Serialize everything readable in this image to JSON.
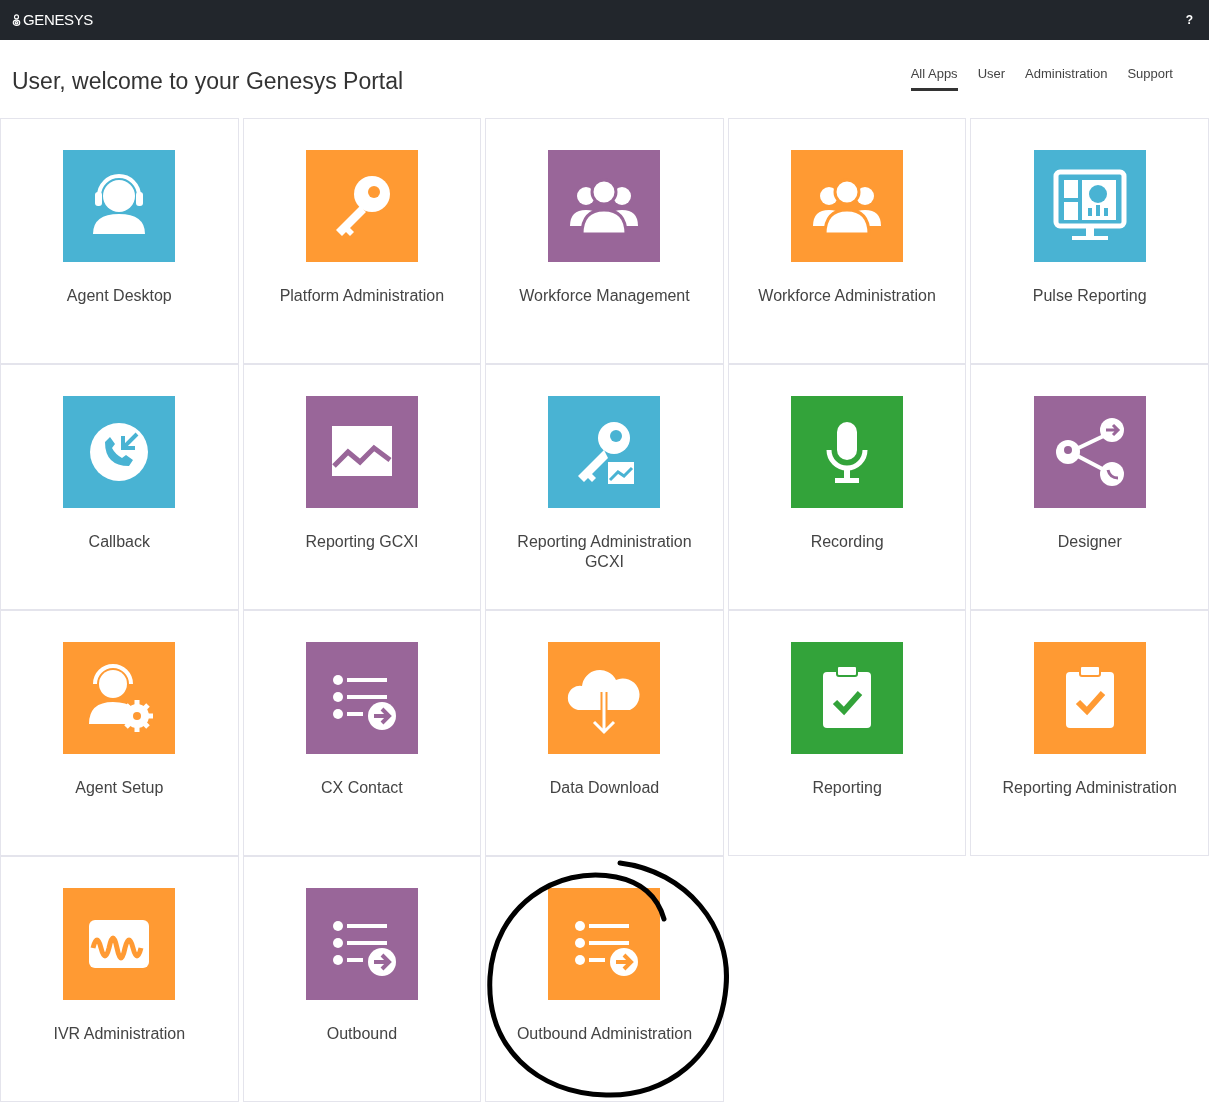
{
  "header": {
    "logo": "GENESYS",
    "help": "?"
  },
  "welcome": "User, welcome to your Genesys Portal",
  "tabs": [
    {
      "label": "All Apps",
      "selected": true
    },
    {
      "label": "User",
      "selected": false
    },
    {
      "label": "Administration",
      "selected": false
    },
    {
      "label": "Support",
      "selected": false
    }
  ],
  "apps": [
    {
      "label": "Agent Desktop",
      "kind": "headset",
      "color": "#49b3d3",
      "circled": false
    },
    {
      "label": "Platform Administration",
      "kind": "key",
      "color": "#ff9a33",
      "circled": false
    },
    {
      "label": "Workforce Management",
      "kind": "group",
      "color": "#996699",
      "circled": false
    },
    {
      "label": "Workforce Administration",
      "kind": "group",
      "color": "#ff9a33",
      "circled": false
    },
    {
      "label": "Pulse Reporting",
      "kind": "monitor",
      "color": "#49b3d3",
      "circled": false
    },
    {
      "label": "Callback",
      "kind": "phone",
      "color": "#49b3d3",
      "circled": false
    },
    {
      "label": "Reporting GCXI",
      "kind": "chart",
      "color": "#996699",
      "circled": false
    },
    {
      "label": "Reporting Administration GCXI",
      "kind": "keychart",
      "color": "#49b3d3",
      "circled": false
    },
    {
      "label": "Recording",
      "kind": "mic",
      "color": "#33a33a",
      "circled": false
    },
    {
      "label": "Designer",
      "kind": "share",
      "color": "#996699",
      "circled": false
    },
    {
      "label": "Agent Setup",
      "kind": "persongear",
      "color": "#ff9a33",
      "circled": false
    },
    {
      "label": "CX Contact",
      "kind": "list",
      "color": "#996699",
      "circled": false
    },
    {
      "label": "Data Download",
      "kind": "cloud",
      "color": "#ff9a33",
      "circled": false
    },
    {
      "label": "Reporting",
      "kind": "clipboard",
      "color": "#33a33a",
      "circled": false
    },
    {
      "label": "Reporting Administration",
      "kind": "clipboard",
      "color": "#ff9a33",
      "circled": false
    },
    {
      "label": "IVR Administration",
      "kind": "wave",
      "color": "#ff9a33",
      "circled": false
    },
    {
      "label": "Outbound",
      "kind": "list",
      "color": "#996699",
      "circled": false
    },
    {
      "label": "Outbound Administration",
      "kind": "list",
      "color": "#ff9a33",
      "circled": true
    }
  ]
}
